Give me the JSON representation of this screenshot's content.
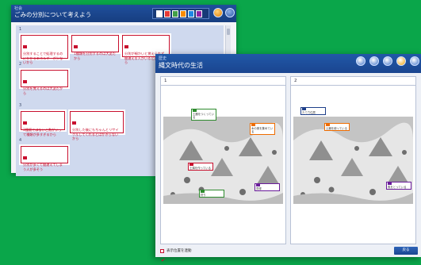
{
  "back_window": {
    "kicker": "社会",
    "title": "ごみの分別について考えよう",
    "color_swatches": [
      "#ffffff",
      "#e53935",
      "#43a047",
      "#fb8c00",
      "#1e88e5",
      "#8e24aa"
    ],
    "toolbar_icon": "rewind-icon",
    "sections": [
      {
        "number": "1",
        "cards": [
          "分別することで処理するのにかかるエネルギーが少ないから",
          "1種類を分別するのは大変だから",
          "分別が細かいと覚えられず間違える人がいると困るから"
        ]
      },
      {
        "number": "2",
        "cards": [
          "分別を覚えるのは大変だから"
        ]
      },
      {
        "number": "3",
        "cards": [
          "3種類ではないと数がいって種類が多すぎるから",
          "分別した後にもちゃんとリサイクルしてくれるとはかぎらないから"
        ]
      },
      {
        "number": "4",
        "cards": [
          "分別が多くて間違えてしまう人が多そう"
        ]
      }
    ]
  },
  "front_window": {
    "kicker": "歴史",
    "title": "縄文時代の生活",
    "toolbar_icons": [
      "globe-icon",
      "grid-icon",
      "list-icon",
      "bag-icon",
      "home-icon"
    ],
    "toolbar_labels": [
      "",
      "",
      "",
      "",
      ""
    ],
    "panels": [
      {
        "number": "1",
        "labels": [
          {
            "text": "土器をつくっている",
            "color": "#2e8b2e"
          },
          {
            "text": "木の実を集めている",
            "color": "#ef6c00"
          },
          {
            "text": "土偶を作っている",
            "color": "#c8102e"
          },
          {
            "text": "貝塚",
            "color": "#6a1b9a"
          },
          {
            "text": "狩り",
            "color": "#2e8b2e"
          }
        ]
      },
      {
        "number": "2",
        "labels": [
          {
            "text": "たて穴住居",
            "color": "#1e3f8a"
          },
          {
            "text": "土器を使っている",
            "color": "#ef6c00"
          },
          {
            "text": "魚をとっている",
            "color": "#6a1b9a"
          }
        ]
      }
    ],
    "footer": {
      "checkbox_label": "表示位置を連動",
      "action_label": "戻る"
    }
  }
}
